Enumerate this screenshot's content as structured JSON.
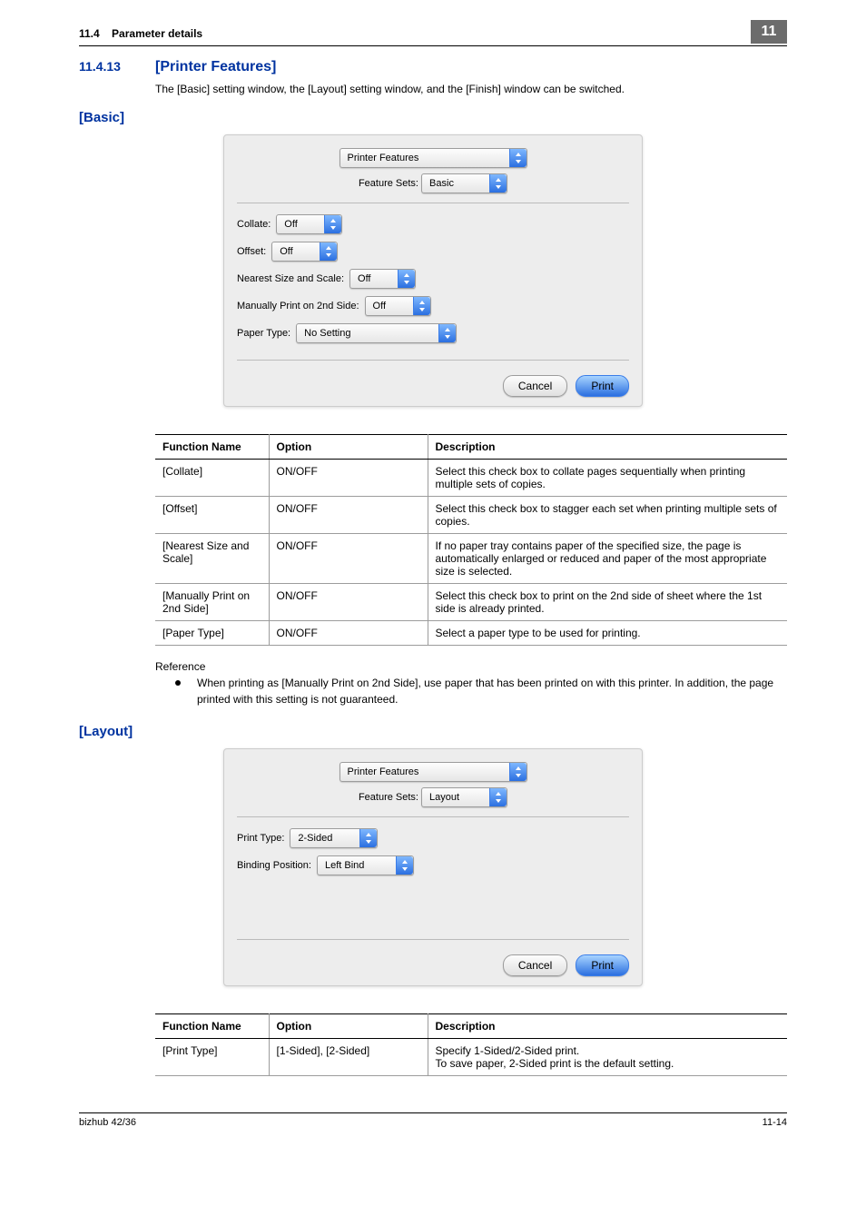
{
  "header": {
    "section_no": "11.4",
    "section_title": "Parameter details",
    "chapter_badge": "11"
  },
  "h2": {
    "num": "11.4.13",
    "title": "[Printer Features]"
  },
  "intro": "The [Basic] setting window, the [Layout] setting window, and the [Finish] window can be switched.",
  "basic": {
    "heading": "[Basic]",
    "dialog": {
      "main_select": "Printer Features",
      "feature_sets_label": "Feature Sets:",
      "feature_sets_value": "Basic",
      "fields": {
        "collate_label": "Collate:",
        "collate_value": "Off",
        "offset_label": "Offset:",
        "offset_value": "Off",
        "nearest_label": "Nearest Size and Scale:",
        "nearest_value": "Off",
        "manual_label": "Manually Print on 2nd Side:",
        "manual_value": "Off",
        "paper_type_label": "Paper Type:",
        "paper_type_value": "No Setting"
      },
      "cancel": "Cancel",
      "print": "Print"
    },
    "table": {
      "head": {
        "c1": "Function Name",
        "c2": "Option",
        "c3": "Description"
      },
      "rows": [
        {
          "c1": "[Collate]",
          "c2": "ON/OFF",
          "c3": "Select this check box to collate pages sequentially when printing multiple sets of copies."
        },
        {
          "c1": "[Offset]",
          "c2": "ON/OFF",
          "c3": "Select this check box to stagger each set when printing multiple sets of copies."
        },
        {
          "c1": "[Nearest Size and Scale]",
          "c2": "ON/OFF",
          "c3": "If no paper tray contains paper of the specified size, the page is automatically enlarged or reduced and paper of the most appropriate size is selected."
        },
        {
          "c1": "[Manually Print on 2nd Side]",
          "c2": "ON/OFF",
          "c3": "Select this check box to print on the 2nd side of sheet where the 1st side is already printed."
        },
        {
          "c1": "[Paper Type]",
          "c2": "ON/OFF",
          "c3": "Select a paper type to be used for printing."
        }
      ]
    },
    "reference_label": "Reference",
    "reference_bullet": "When printing as [Manually Print on 2nd Side], use paper that has been printed on with this printer. In addition, the page printed with this setting is not guaranteed."
  },
  "layout": {
    "heading": "[Layout]",
    "dialog": {
      "main_select": "Printer Features",
      "feature_sets_label": "Feature Sets:",
      "feature_sets_value": "Layout",
      "fields": {
        "print_type_label": "Print Type:",
        "print_type_value": "2-Sided",
        "binding_label": "Binding Position:",
        "binding_value": "Left Bind"
      },
      "cancel": "Cancel",
      "print": "Print"
    },
    "table": {
      "head": {
        "c1": "Function Name",
        "c2": "Option",
        "c3": "Description"
      },
      "rows": [
        {
          "c1": "[Print Type]",
          "c2": "[1-Sided], [2-Sided]",
          "c3": "Specify 1-Sided/2-Sided print.\nTo save paper, 2-Sided print is the default setting."
        }
      ]
    }
  },
  "footer": {
    "left": "bizhub 42/36",
    "right": "11-14"
  }
}
